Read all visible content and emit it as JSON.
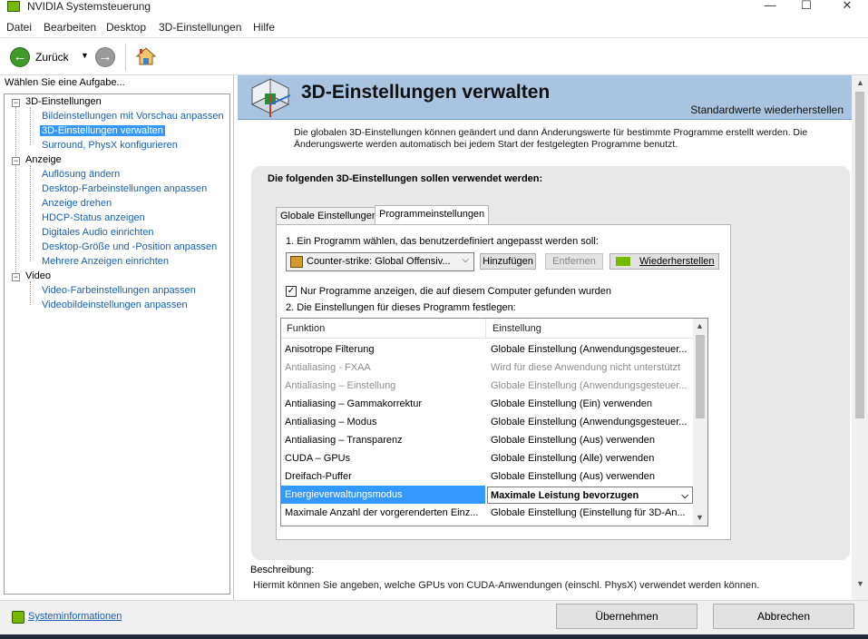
{
  "window": {
    "title": "NVIDIA Systemsteuerung",
    "controls": [
      "—",
      "☐",
      "✕"
    ]
  },
  "menu": [
    "Datei",
    "Bearbeiten",
    "Desktop",
    "3D-Einstellungen",
    "Hilfe"
  ],
  "toolbar": {
    "back_label": "Zurück"
  },
  "left": {
    "heading": "Wählen Sie eine Aufgabe...",
    "groups": [
      {
        "label": "3D-Einstellungen",
        "items": [
          "Bildeinstellungen mit Vorschau anpassen",
          "3D-Einstellungen verwalten",
          "Surround, PhysX konfigurieren"
        ]
      },
      {
        "label": "Anzeige",
        "items": [
          "Auflösung ändern",
          "Desktop-Farbeinstellungen anpassen",
          "Anzeige drehen",
          "HDCP-Status anzeigen",
          "Digitales Audio einrichten",
          "Desktop-Größe und -Position anpassen",
          "Mehrere Anzeigen einrichten"
        ]
      },
      {
        "label": "Video",
        "items": [
          "Video-Farbeinstellungen anpassen",
          "Videobildeinstellungen anpassen"
        ]
      }
    ]
  },
  "main": {
    "title": "3D-Einstellungen verwalten",
    "restore_defaults": "Standardwerte wiederherstellen",
    "intro_line1": "Die globalen 3D-Einstellungen können geändert und dann Änderungswerte für bestimmte Programme erstellt werden. Die",
    "intro_line2": "Änderungswerte werden automatisch bei jedem Start der festgelegten Programme benutzt.",
    "section_title": "Die folgenden 3D-Einstellungen sollen verwendet werden:",
    "tabs": [
      "Globale Einstellungen",
      "Programmeinstellungen"
    ],
    "step1": "1. Ein Programm wählen, das benutzerdefiniert angepasst werden soll:",
    "program_selected": "Counter-strike: Global Offensiv...",
    "btn_add": "Hinzufügen",
    "btn_remove": "Entfernen",
    "btn_restore": "Wiederherstellen",
    "checkbox_label": "Nur Programme anzeigen, die auf diesem Computer gefunden wurden",
    "step2": "2. Die Einstellungen für dieses Programm festlegen:",
    "col_function": "Funktion",
    "col_setting": "Einstellung",
    "rows": [
      {
        "f": "Anisotrope Filterung",
        "s": "Globale Einstellung (Anwendungsgesteuer..."
      },
      {
        "f": "Antialiasing - FXAA",
        "s": "Wird für diese Anwendung nicht unterstützt"
      },
      {
        "f": "Antialiasing – Einstellung",
        "s": "Globale Einstellung (Anwendungsgesteuer..."
      },
      {
        "f": "Antialiasing – Gammakorrektur",
        "s": "Globale Einstellung (Ein) verwenden"
      },
      {
        "f": "Antialiasing – Modus",
        "s": "Globale Einstellung (Anwendungsgesteuer..."
      },
      {
        "f": "Antialiasing – Transparenz",
        "s": "Globale Einstellung (Aus) verwenden"
      },
      {
        "f": "CUDA – GPUs",
        "s": "Globale Einstellung (Alle) verwenden"
      },
      {
        "f": "Dreifach-Puffer",
        "s": "Globale Einstellung (Aus) verwenden"
      },
      {
        "f": "Energieverwaltungsmodus",
        "s": "Maximale Leistung bevorzugen"
      },
      {
        "f": "Maximale Anzahl der vorgerenderten Einz...",
        "s": "Globale Einstellung (Einstellung für 3D-An..."
      }
    ],
    "description_label": "Beschreibung:",
    "description_text": "Hiermit können Sie angeben, welche GPUs von CUDA-Anwendungen (einschl. PhysX) verwendet werden können."
  },
  "footer": {
    "sysinfo": "Systeminformationen",
    "apply": "Übernehmen",
    "cancel": "Abbrechen"
  },
  "colors": {
    "selection": "#3399ff",
    "banner": "#a9c4e0",
    "nvidia_green": "#76b900",
    "link": "#1a5fb4"
  }
}
